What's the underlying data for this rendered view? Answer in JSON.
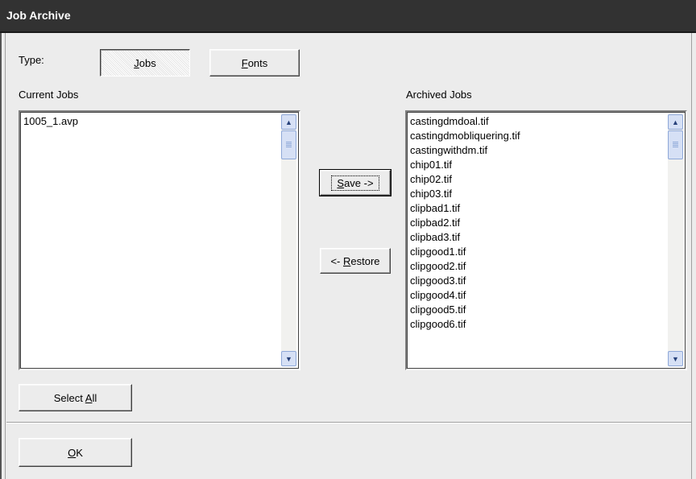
{
  "window": {
    "title": "Job Archive"
  },
  "type_selector": {
    "label": "Type:",
    "jobs": {
      "prefix": "",
      "accel": "J",
      "rest": "obs"
    },
    "fonts": {
      "prefix": "",
      "accel": "F",
      "rest": "onts"
    }
  },
  "current_jobs": {
    "label": "Current Jobs",
    "items": [
      "1005_1.avp"
    ]
  },
  "archived_jobs": {
    "label": "Archived Jobs",
    "items": [
      "castingdmdoal.tif",
      "castingdmobliquering.tif",
      "castingwithdm.tif",
      "chip01.tif",
      "chip02.tif",
      "chip03.tif",
      "clipbad1.tif",
      "clipbad2.tif",
      "clipbad3.tif",
      "clipgood1.tif",
      "clipgood2.tif",
      "clipgood3.tif",
      "clipgood4.tif",
      "clipgood5.tif",
      "clipgood6.tif"
    ]
  },
  "actions": {
    "save": {
      "prefix": "",
      "accel": "S",
      "rest": "ave ->"
    },
    "restore": {
      "prefix": "<- ",
      "accel": "R",
      "rest": "estore"
    },
    "select_all": {
      "prefix": "Select ",
      "accel": "A",
      "rest": "ll"
    },
    "ok": {
      "prefix": "",
      "accel": "O",
      "rest": "K"
    }
  },
  "icons": {
    "scroll_up": "chevron-up-icon",
    "scroll_down": "chevron-down-icon"
  },
  "colors": {
    "titlebar": "#323232",
    "dialog_bg": "#ececec",
    "scroll_accent": "#d6e0f5"
  }
}
